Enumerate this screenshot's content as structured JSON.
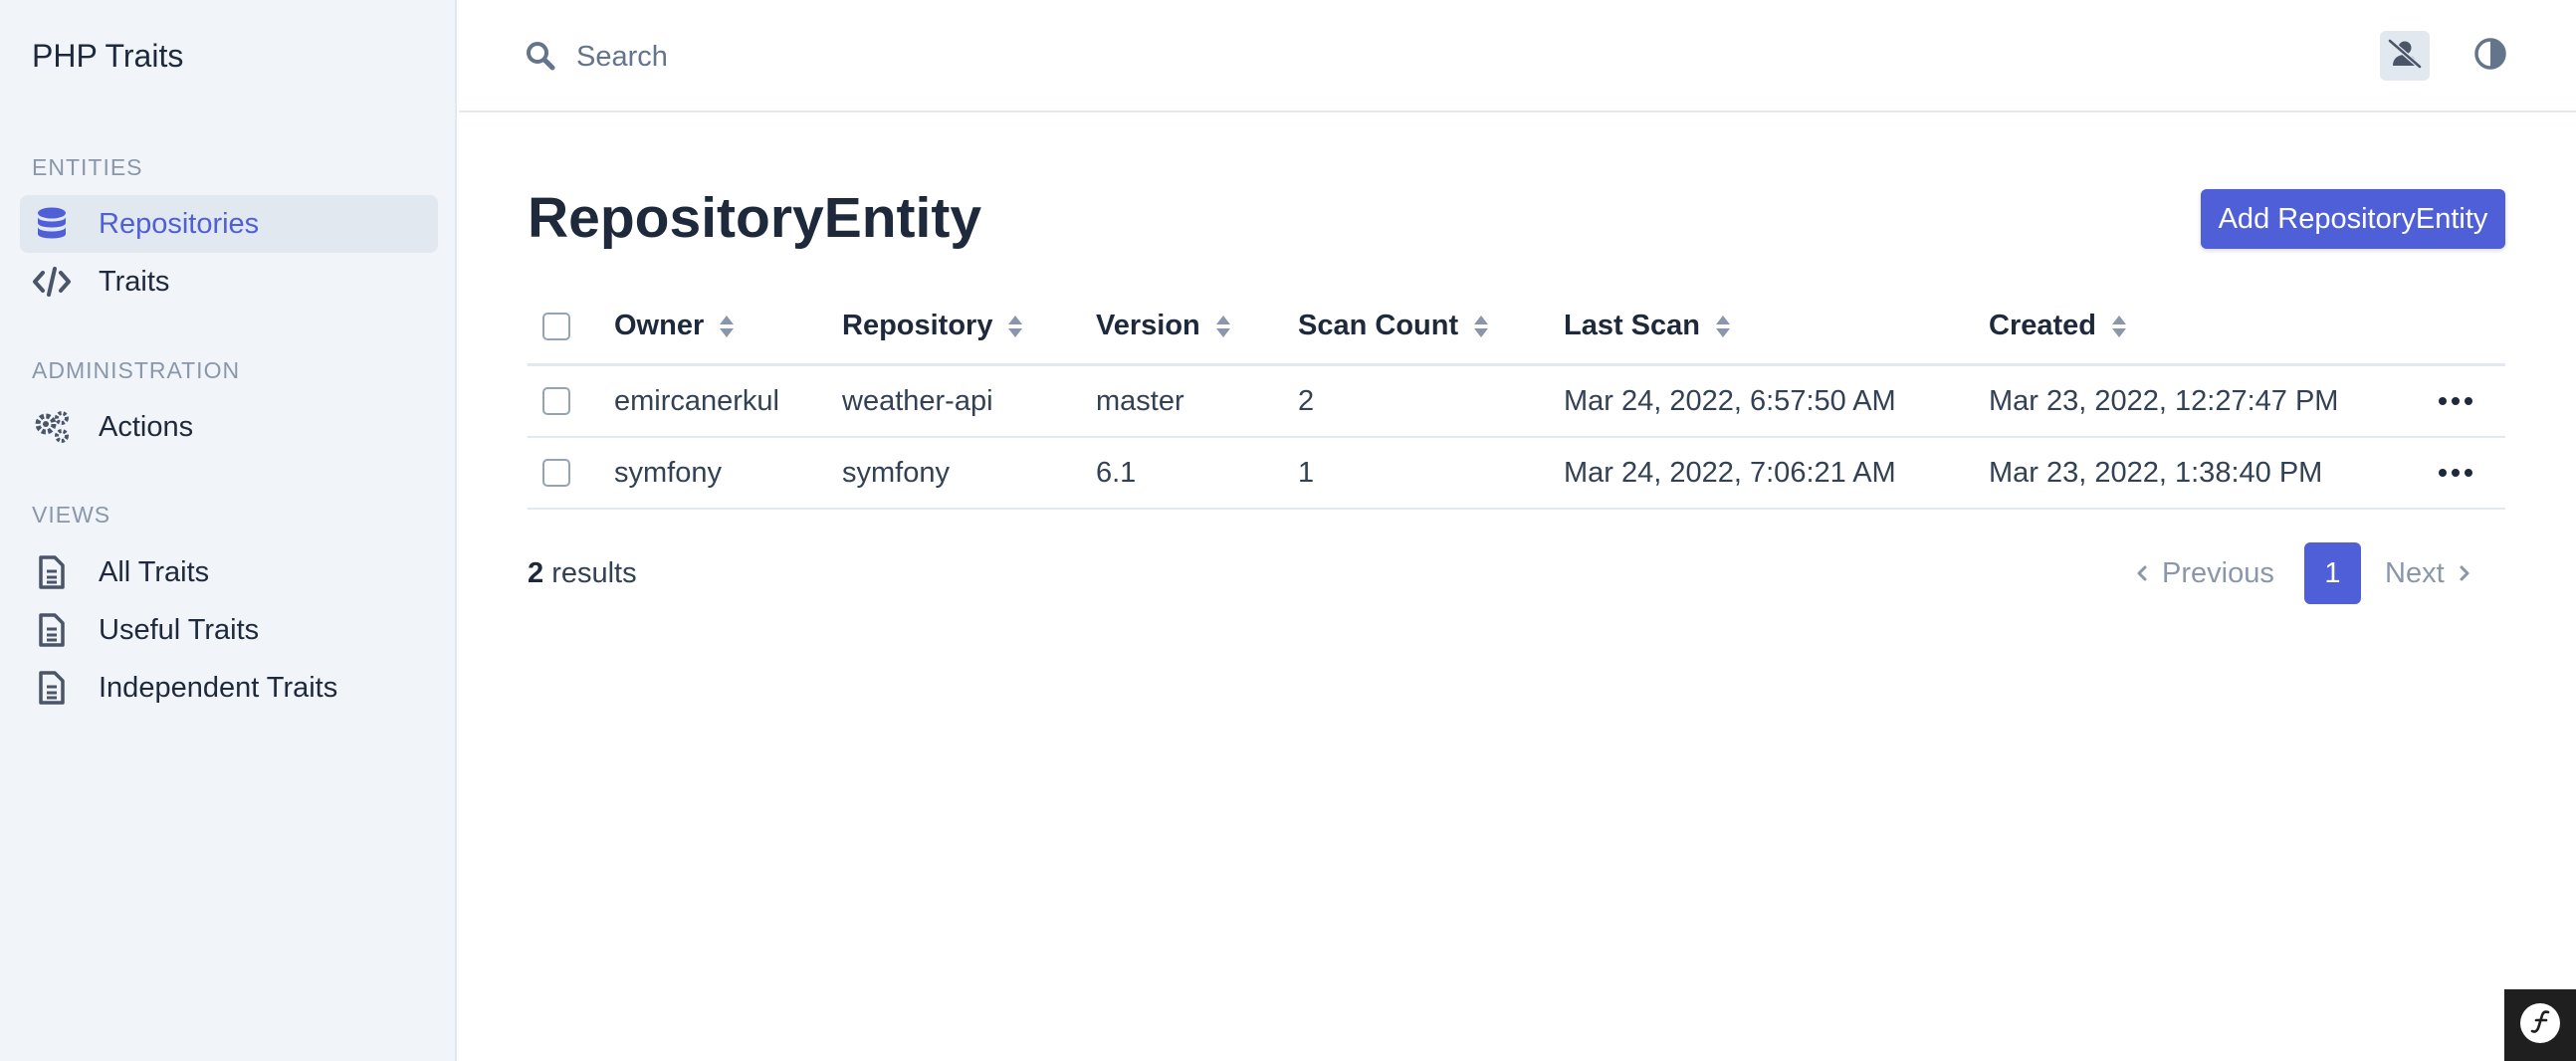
{
  "app": {
    "title": "PHP Traits"
  },
  "sidebar": {
    "sections": [
      {
        "label": "ENTITIES"
      },
      {
        "label": "ADMINISTRATION"
      },
      {
        "label": "VIEWS"
      }
    ],
    "items": [
      {
        "label": "Repositories",
        "icon": "database-icon",
        "active": true
      },
      {
        "label": "Traits",
        "icon": "code-icon"
      },
      {
        "label": "Actions",
        "icon": "gears-icon"
      },
      {
        "label": "All Traits",
        "icon": "document-icon"
      },
      {
        "label": "Useful Traits",
        "icon": "document-icon"
      },
      {
        "label": "Independent Traits",
        "icon": "document-icon"
      }
    ]
  },
  "topbar": {
    "search_placeholder": "Search",
    "user_icon": "user-slash-icon",
    "theme_icon": "contrast-icon"
  },
  "main": {
    "title": "RepositoryEntity",
    "add_button": "Add RepositoryEntity",
    "columns": [
      "Owner",
      "Repository",
      "Version",
      "Scan Count",
      "Last Scan",
      "Created"
    ],
    "rows": [
      [
        "emircanerkul",
        "weather-api",
        "master",
        "2",
        "Mar 24, 2022, 6:57:50 AM",
        "Mar 23, 2022, 12:27:47 PM"
      ],
      [
        "symfony",
        "symfony",
        "6.1",
        "1",
        "Mar 24, 2022, 7:06:21 AM",
        "Mar 23, 2022, 1:38:40 PM"
      ]
    ],
    "results_count": "2",
    "results_label": " results",
    "pagination": {
      "previous": "Previous",
      "page": "1",
      "next": "Next"
    }
  },
  "colors": {
    "accent": "#4f5fd7",
    "sidebar_bg": "#f1f5f9",
    "text": "#1e293b",
    "muted": "#8a97ab"
  }
}
